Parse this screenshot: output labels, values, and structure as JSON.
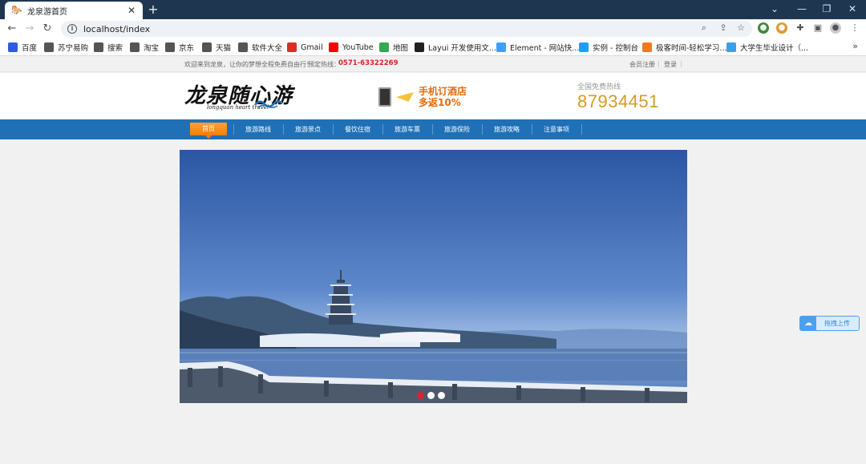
{
  "browser": {
    "tab_title": "龙泉游首页",
    "new_tab": "+",
    "url": "localhost/index",
    "window": {
      "minimize": "—",
      "restore": "❐",
      "close": "✕",
      "chevron": "⌄"
    },
    "bookmarks": [
      {
        "label": "百度",
        "icon": "paw-icon",
        "color": "#2d5be3"
      },
      {
        "label": "苏宁易购",
        "icon": "globe-icon",
        "color": "#555555"
      },
      {
        "label": "搜索",
        "icon": "globe-icon",
        "color": "#555555"
      },
      {
        "label": "淘宝",
        "icon": "globe-icon",
        "color": "#555555"
      },
      {
        "label": "京东",
        "icon": "globe-icon",
        "color": "#555555"
      },
      {
        "label": "天猫",
        "icon": "globe-icon",
        "color": "#555555"
      },
      {
        "label": "软件大全",
        "icon": "globe-icon",
        "color": "#555555"
      },
      {
        "label": "Gmail",
        "icon": "gmail-icon",
        "color": "#d93025"
      },
      {
        "label": "YouTube",
        "icon": "youtube-icon",
        "color": "#ff0000"
      },
      {
        "label": "地图",
        "icon": "maps-icon",
        "color": "#34a853"
      },
      {
        "label": "Layui 开发使用文...",
        "icon": "layui-icon",
        "color": "#222222"
      },
      {
        "label": "Element - 网站快...",
        "icon": "element-icon",
        "color": "#409eff"
      },
      {
        "label": "实例 - 控制台",
        "icon": "cloud-icon",
        "color": "#1e9fff"
      },
      {
        "label": "极客时间-轻松学习...",
        "icon": "geek-icon",
        "color": "#f4781f"
      },
      {
        "label": "大学生毕业设计（...",
        "icon": "grad-icon",
        "color": "#3aa0e8"
      }
    ],
    "more": "»"
  },
  "site": {
    "welcome": "欢迎来到龙泉，让你的梦想全程免费自由行！",
    "hotline_label": "预定热线：",
    "hotline_number": "0571-63322269",
    "register": "会员注册",
    "login": "登录",
    "logo_cn": "龙泉随心游",
    "logo_en": "longquan heart travel",
    "promo_line1": "手机订酒店",
    "promo_line2": "多返10%",
    "free_hotline_label": "全国免费热线",
    "free_hotline_number": "87934451",
    "nav": [
      "首页",
      "旅游路线",
      "旅游景点",
      "餐饮住宿",
      "旅游车票",
      "旅游保险",
      "旅游攻略",
      "注意事项"
    ],
    "active_nav": 0,
    "slider_dots": 3,
    "active_dot": 0,
    "upload_label": "拖拽上传"
  },
  "colors": {
    "nav_blue": "#1f70b6",
    "nav_active": "#f57d0c",
    "hotline_red": "#d9232d",
    "free_hotline_gold": "#d69b24",
    "chrome_dark": "#1f3651"
  }
}
